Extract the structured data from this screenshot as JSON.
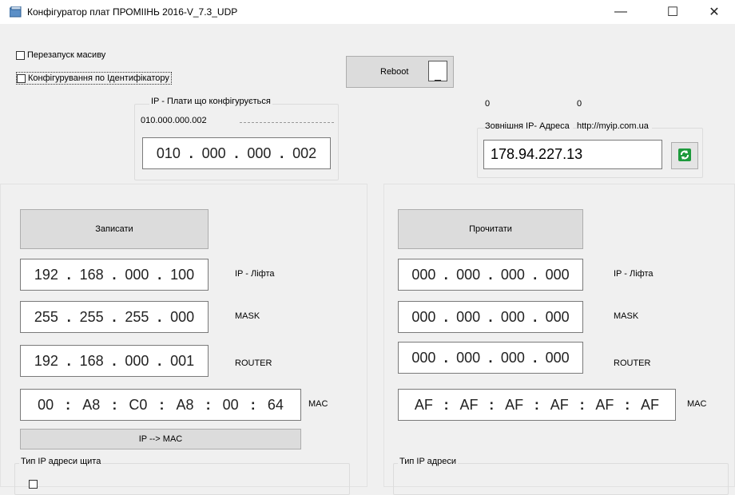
{
  "window": {
    "title": "Конфігуратор плат ПРОМІІНЬ 2016-V_7.3_UDP",
    "minimize": "—",
    "maximize": "☐",
    "close": "✕"
  },
  "options": {
    "restart_array": "Перезапуск масиву",
    "config_by_id": "Конфігурування по Ідентифікатору"
  },
  "reboot": {
    "label": "Reboot",
    "box": "_"
  },
  "board_ip": {
    "caption": "IP - Плати що конфігурується",
    "value_text": "010.000.000.002",
    "octets": [
      "010",
      "000",
      "000",
      "002"
    ]
  },
  "external": {
    "counter_a": "0",
    "counter_b": "0",
    "label": "Зовнішня IP- Адреса",
    "site": "http://myip.com.ua",
    "ip": "178.94.227.13"
  },
  "left": {
    "write_button": "Записати",
    "ip": [
      "192",
      "168",
      "000",
      "100"
    ],
    "ip_label": "IP - Ліфта",
    "mask": [
      "255",
      "255",
      "255",
      "000"
    ],
    "mask_label": "MASK",
    "router": [
      "192",
      "168",
      "000",
      "001"
    ],
    "router_label": "ROUTER",
    "mac": [
      "00",
      "A8",
      "C0",
      "A8",
      "00",
      "64"
    ],
    "mac_label": "MAC",
    "ip_to_mac_button": "IP --> MAC",
    "group_title": "Тип IP адреси щита"
  },
  "right": {
    "read_button": "Прочитати",
    "ip": [
      "000",
      "000",
      "000",
      "000"
    ],
    "ip_label": "IP - Ліфта",
    "mask": [
      "000",
      "000",
      "000",
      "000"
    ],
    "mask_label": "MASK",
    "router": [
      "000",
      "000",
      "000",
      "000"
    ],
    "router_label": "ROUTER",
    "mac": [
      "AF",
      "AF",
      "AF",
      "AF",
      "AF",
      "AF"
    ],
    "mac_label": "MAC",
    "group_title": "Тип IP адреси"
  },
  "separators": {
    "dot": ".",
    "colon": ":"
  },
  "colors": {
    "refresh_icon": "#1d9a3c"
  }
}
